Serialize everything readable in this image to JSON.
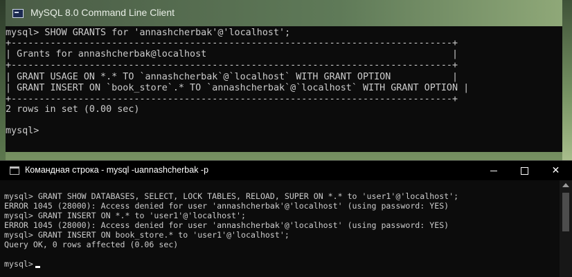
{
  "mysql_window": {
    "title": "MySQL 8.0 Command Line Client",
    "lines": [
      "mysql> SHOW GRANTS for 'annashcherbak'@'localhost';",
      "+-------------------------------------------------------------------------------+",
      "| Grants for annashcherbak@localhost                                            |",
      "+-------------------------------------------------------------------------------+",
      "| GRANT USAGE ON *.* TO `annashcherbak`@`localhost` WITH GRANT OPTION           |",
      "| GRANT INSERT ON `book_store`.* TO `annashcherbak`@`localhost` WITH GRANT OPTION |",
      "+-------------------------------------------------------------------------------+",
      "2 rows in set (0.00 sec)",
      "",
      "mysql>"
    ]
  },
  "cmd_window": {
    "title": "Командная строка - mysql  -uannashcherbak -p",
    "lines": [
      "mysql> GRANT SHOW DATABASES, SELECT, LOCK TABLES, RELOAD, SUPER ON *.* to 'user1'@'localhost';",
      "ERROR 1045 (28000): Access denied for user 'annashcherbak'@'localhost' (using password: YES)",
      "mysql> GRANT INSERT ON *.* to 'user1'@'localhost';",
      "ERROR 1045 (28000): Access denied for user 'annashcherbak'@'localhost' (using password: YES)",
      "mysql> GRANT INSERT ON book_store.* to 'user1'@'localhost';",
      "Query OK, 0 rows affected (0.06 sec)",
      "",
      "mysql>"
    ],
    "buttons": {
      "minimize": "minimize",
      "maximize": "maximize",
      "close": "close"
    }
  },
  "icons": {
    "mysql_app": "mysql-console-icon",
    "cmd_app": "cmd-console-icon",
    "scroll_up": "arrow-up-icon"
  }
}
